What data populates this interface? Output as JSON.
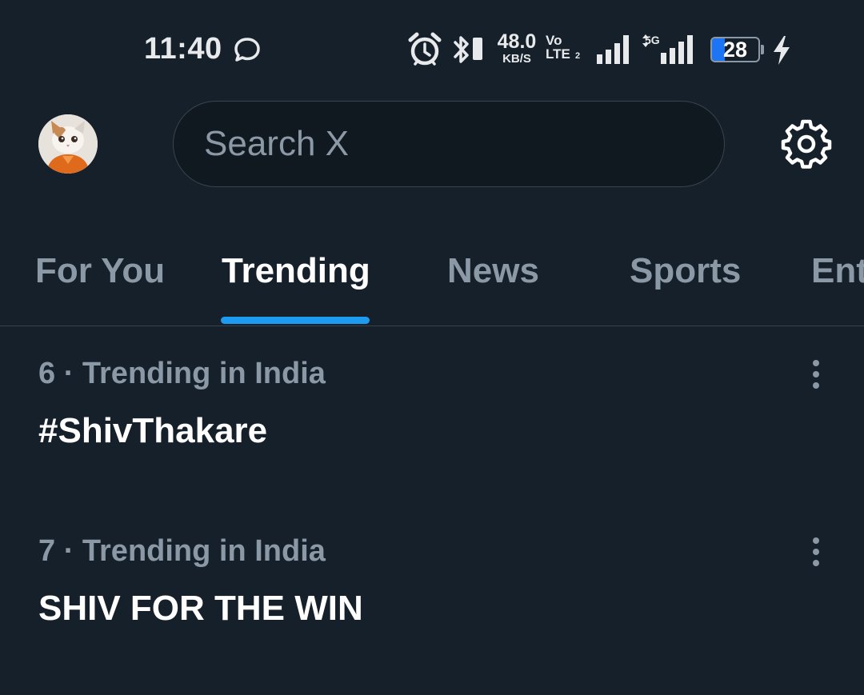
{
  "status_bar": {
    "time": "11:40",
    "message_icon": "message-bubble-icon",
    "alarm_icon": "alarm-icon",
    "bluetooth_icon": "bluetooth-icon",
    "vibrate_icon": "vibrate-icon",
    "network_speed": "48.0",
    "network_speed_unit": "KB/S",
    "volte_top": "Vo",
    "volte_bottom": "LTE",
    "sim_slot": "2",
    "network_type": "5G",
    "battery_level": "28",
    "battery_fraction": 0.28,
    "charging_icon": "lightning-bolt-icon"
  },
  "header": {
    "avatar_icon": "profile-avatar-icon",
    "search_placeholder": "Search X",
    "settings_icon": "gear-icon"
  },
  "tabs": [
    {
      "label": "For You",
      "active": false
    },
    {
      "label": "Trending",
      "active": true
    },
    {
      "label": "News",
      "active": false
    },
    {
      "label": "Sports",
      "active": false
    },
    {
      "label": "Ent",
      "active": false
    }
  ],
  "trends": [
    {
      "context": "6 · Trending in India",
      "name": "#ShivThakare"
    },
    {
      "context": "7 · Trending in India",
      "name": "SHIV FOR THE WIN"
    }
  ],
  "colors": {
    "background": "#15202b",
    "accent": "#1d9bf0",
    "secondary_text": "#8b98a5",
    "primary_text": "#ffffff",
    "divider": "#38444d",
    "battery_fill": "#1d74f5"
  }
}
